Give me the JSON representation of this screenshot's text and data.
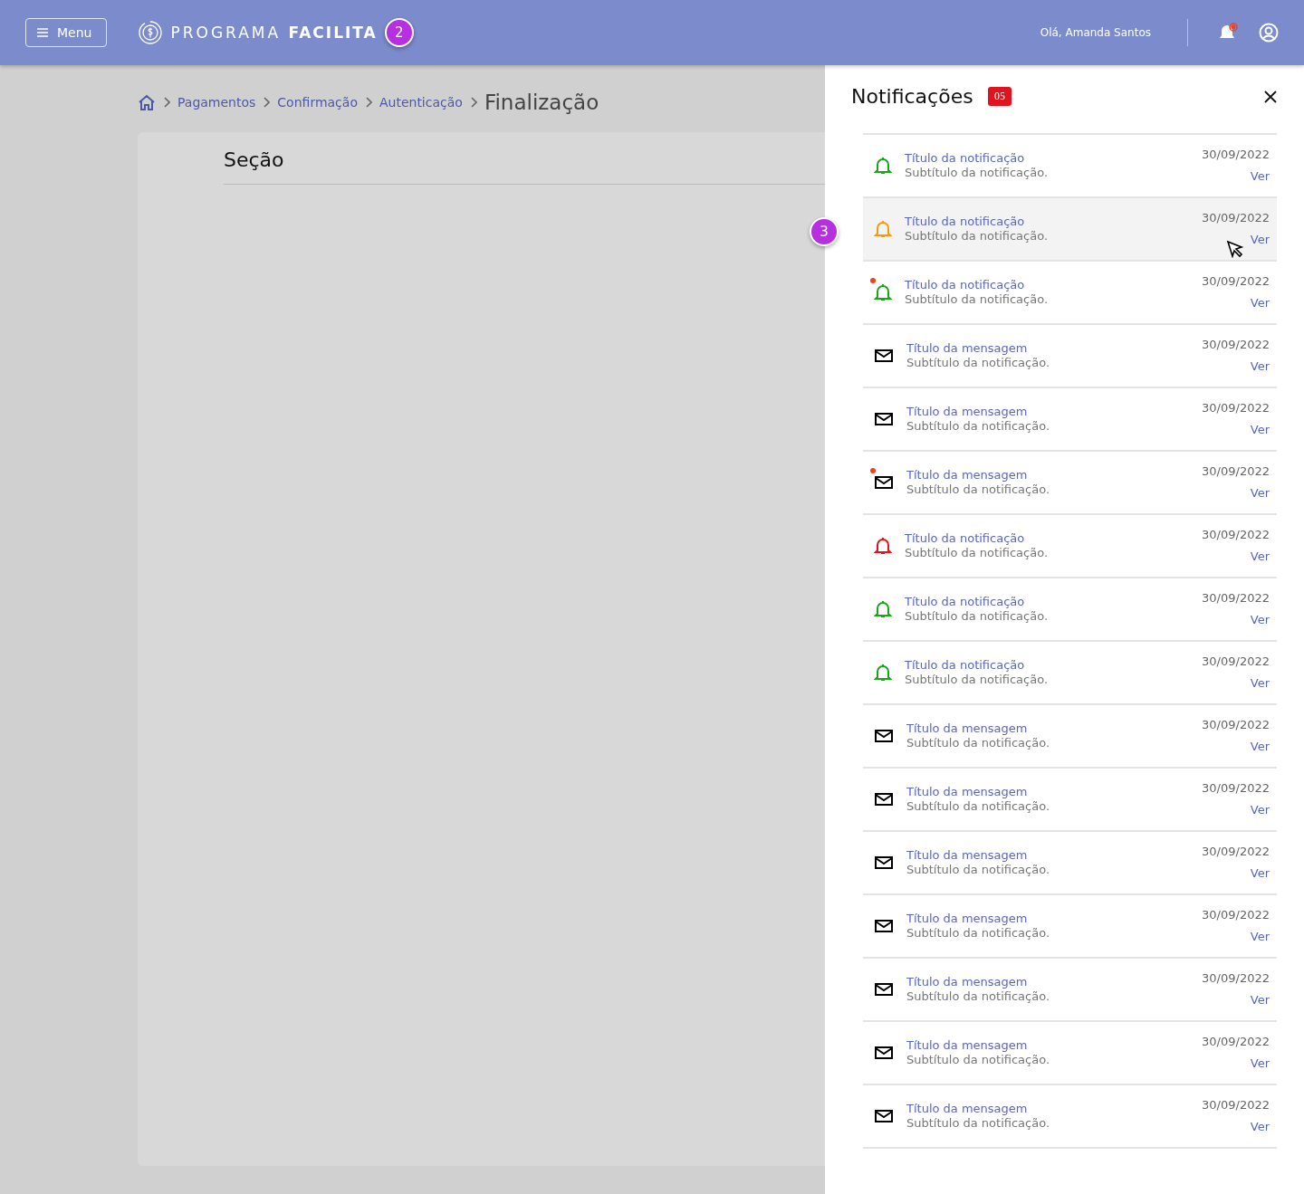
{
  "header": {
    "menu_button": "Menu",
    "logo": {
      "light": "PROGRAMA",
      "bold": "FACILITA"
    },
    "greeting": "Olá, Amanda Santos",
    "notifications_alert": true
  },
  "markers": [
    "2",
    "3"
  ],
  "breadcrumb": {
    "items": [
      "Pagamentos",
      "Confirmação",
      "Autenticação"
    ],
    "current": "Finalização"
  },
  "section": {
    "title": "Seção"
  },
  "panel": {
    "title": "Notificações",
    "count": "05",
    "items": [
      {
        "kind": "bell",
        "color": "#1aa51a",
        "title": "Título da notificação",
        "subtitle": "Subtítulo da notificação.",
        "date": "30/09/2022",
        "action": "Ver",
        "unread": false,
        "highlighted": false
      },
      {
        "kind": "bell",
        "color": "#f59a0c",
        "title": "Título da notificação",
        "subtitle": "Subtítulo da notificação.",
        "date": "30/09/2022",
        "action": "Ver",
        "unread": false,
        "highlighted": true
      },
      {
        "kind": "bell",
        "color": "#1aa51a",
        "title": "Título da notificação",
        "subtitle": "Subtítulo da notificação.",
        "date": "30/09/2022",
        "action": "Ver",
        "unread": true,
        "highlighted": false
      },
      {
        "kind": "mail",
        "title": "Título da mensagem",
        "subtitle": "Subtítulo da notificação.",
        "date": "30/09/2022",
        "action": "Ver",
        "unread": false,
        "highlighted": false
      },
      {
        "kind": "mail",
        "title": "Título da mensagem",
        "subtitle": "Subtítulo da notificação.",
        "date": "30/09/2022",
        "action": "Ver",
        "unread": false,
        "highlighted": false
      },
      {
        "kind": "mail",
        "title": "Título da mensagem",
        "subtitle": "Subtítulo da notificação.",
        "date": "30/09/2022",
        "action": "Ver",
        "unread": true,
        "highlighted": false
      },
      {
        "kind": "bell",
        "color": "#e0141e",
        "title": "Título da notificação",
        "subtitle": "Subtítulo da notificação.",
        "date": "30/09/2022",
        "action": "Ver",
        "unread": false,
        "highlighted": false
      },
      {
        "kind": "bell",
        "color": "#1aa51a",
        "title": "Título da notificação",
        "subtitle": "Subtítulo da notificação.",
        "date": "30/09/2022",
        "action": "Ver",
        "unread": false,
        "highlighted": false
      },
      {
        "kind": "bell",
        "color": "#1aa51a",
        "title": "Título da notificação",
        "subtitle": "Subtítulo da notificação.",
        "date": "30/09/2022",
        "action": "Ver",
        "unread": false,
        "highlighted": false
      },
      {
        "kind": "mail",
        "title": "Título da mensagem",
        "subtitle": "Subtítulo da notificação.",
        "date": "30/09/2022",
        "action": "Ver",
        "unread": false,
        "highlighted": false
      },
      {
        "kind": "mail",
        "title": "Título da mensagem",
        "subtitle": "Subtítulo da notificação.",
        "date": "30/09/2022",
        "action": "Ver",
        "unread": false,
        "highlighted": false
      },
      {
        "kind": "mail",
        "title": "Título da mensagem",
        "subtitle": "Subtítulo da notificação.",
        "date": "30/09/2022",
        "action": "Ver",
        "unread": false,
        "highlighted": false
      },
      {
        "kind": "mail",
        "title": "Título da mensagem",
        "subtitle": "Subtítulo da notificação.",
        "date": "30/09/2022",
        "action": "Ver",
        "unread": false,
        "highlighted": false
      },
      {
        "kind": "mail",
        "title": "Título da mensagem",
        "subtitle": "Subtítulo da notificação.",
        "date": "30/09/2022",
        "action": "Ver",
        "unread": false,
        "highlighted": false
      },
      {
        "kind": "mail",
        "title": "Título da mensagem",
        "subtitle": "Subtítulo da notificação.",
        "date": "30/09/2022",
        "action": "Ver",
        "unread": false,
        "highlighted": false
      },
      {
        "kind": "mail",
        "title": "Título da mensagem",
        "subtitle": "Subtítulo da notificação.",
        "date": "30/09/2022",
        "action": "Ver",
        "unread": false,
        "highlighted": false
      }
    ]
  }
}
